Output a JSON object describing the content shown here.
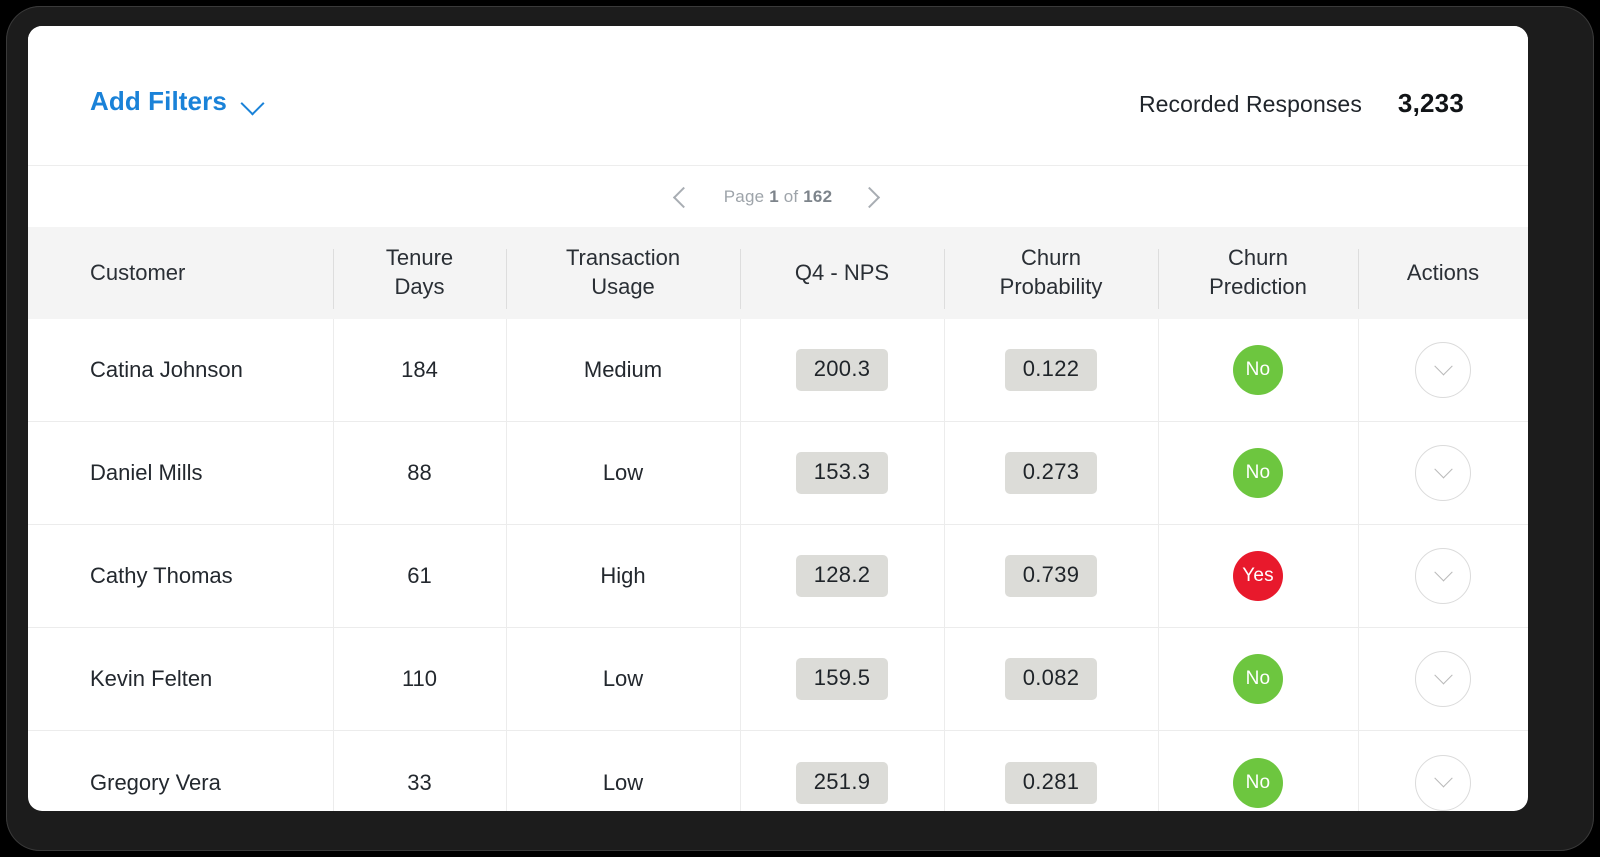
{
  "toolbar": {
    "add_filters_label": "Add Filters",
    "chevron_icon": "chevron-down-icon",
    "responses_label": "Recorded Responses",
    "responses_value": "3,233"
  },
  "pagination": {
    "prev_icon": "chevron-left-icon",
    "next_icon": "chevron-right-icon",
    "prefix": "Page ",
    "current_page": "1",
    "middle": " of ",
    "total_pages": "162"
  },
  "table": {
    "columns": [
      {
        "id": "customer",
        "label": "Customer"
      },
      {
        "id": "tenure",
        "label": "Tenure\nDays",
        "line1": "Tenure",
        "line2": "Days"
      },
      {
        "id": "usage",
        "label": "Transaction\nUsage",
        "line1": "Transaction",
        "line2": "Usage"
      },
      {
        "id": "nps",
        "label": "Q4 - NPS"
      },
      {
        "id": "churn_probability",
        "label": "Churn\nProbability",
        "line1": "Churn",
        "line2": "Probability"
      },
      {
        "id": "churn_prediction",
        "label": "Churn\nPrediction",
        "line1": "Churn",
        "line2": "Prediction"
      },
      {
        "id": "actions",
        "label": "Actions"
      }
    ],
    "rows": [
      {
        "customer": "Catina Johnson",
        "tenure": "184",
        "usage": "Medium",
        "nps": "200.3",
        "churn_probability": "0.122",
        "churn_prediction": "No",
        "prediction_state": "no",
        "action_icon": "chevron-down-icon"
      },
      {
        "customer": "Daniel Mills",
        "tenure": "88",
        "usage": "Low",
        "nps": "153.3",
        "churn_probability": "0.273",
        "churn_prediction": "No",
        "prediction_state": "no",
        "action_icon": "chevron-down-icon"
      },
      {
        "customer": "Cathy Thomas",
        "tenure": "61",
        "usage": "High",
        "nps": "128.2",
        "churn_probability": "0.739",
        "churn_prediction": "Yes",
        "prediction_state": "yes",
        "action_icon": "chevron-down-icon"
      },
      {
        "customer": "Kevin Felten",
        "tenure": "110",
        "usage": "Low",
        "nps": "159.5",
        "churn_probability": "0.082",
        "churn_prediction": "No",
        "prediction_state": "no",
        "action_icon": "chevron-down-icon"
      },
      {
        "customer": "Gregory Vera",
        "tenure": "33",
        "usage": "Low",
        "nps": "251.9",
        "churn_probability": "0.281",
        "churn_prediction": "No",
        "prediction_state": "no",
        "action_icon": "chevron-down-icon"
      }
    ]
  },
  "colors": {
    "link": "#1a82d8",
    "badge_no": "#6dc63f",
    "badge_yes": "#e8192c",
    "header_bg": "#f4f4f4",
    "pill_bg": "#dcdcd8"
  }
}
